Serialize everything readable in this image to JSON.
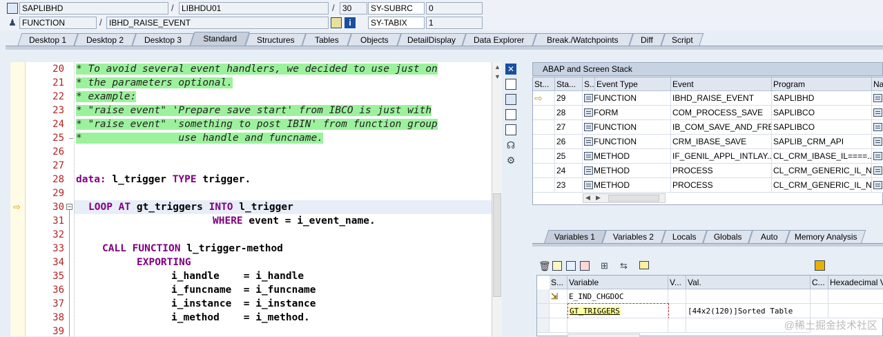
{
  "header": {
    "row1": {
      "program": "SAPLIBHD",
      "include": "LIBHDU01",
      "line": "30",
      "var_name": "SY-SUBRC",
      "var_value": "0"
    },
    "row2": {
      "type": "FUNCTION",
      "name": "IBHD_RAISE_EVENT",
      "var_name": "SY-TABIX",
      "var_value": "1"
    }
  },
  "tabs": [
    "Desktop 1",
    "Desktop 2",
    "Desktop 3",
    "Standard",
    "Structures",
    "Tables",
    "Objects",
    "DetailDisplay",
    "Data Explorer",
    "Break./Watchpoints",
    "Diff",
    "Script"
  ],
  "active_tab": "Standard",
  "code": {
    "line_numbers": [
      "20",
      "21",
      "22",
      "23",
      "24",
      "25",
      "26",
      "27",
      "28",
      "29",
      "30",
      "31",
      "32",
      "33",
      "34",
      "35",
      "36",
      "37",
      "38",
      "39"
    ],
    "lines": {
      "l20": "* To avoid several event handlers, we decided to use just on",
      "l21": "* the parameters optional.",
      "l22": "* example:",
      "l23": "* \"raise event\" 'Prepare save start' from IBCO is just with",
      "l24": "* \"raise event\" 'something to post IBIN' from function group",
      "l25": "*                use handle and funcname.",
      "l28_kw": "data:",
      "l28_rest": " l_trigger ",
      "l28_kw2": "TYPE",
      "l28_rest2": " trigger.",
      "l30_kw": "LOOP AT",
      "l30_a": " gt_triggers ",
      "l30_kw2": "INTO",
      "l30_b": " l_trigger",
      "l31_kw": "WHERE",
      "l31_rest": " event = i_event_name.",
      "l33_kw": "CALL FUNCTION",
      "l33_rest": " l_trigger-method",
      "l34_kw": "EXPORTING",
      "l35": "i_handle    = i_handle",
      "l36": "i_funcname  = i_funcname",
      "l37": "i_instance  = i_instance",
      "l38": "i_method    = i_method."
    }
  },
  "stack": {
    "title": "ABAP and Screen Stack",
    "columns": [
      "St...",
      "Sta...",
      "S...",
      "Event Type",
      "Event",
      "Program",
      "Na"
    ],
    "rows": [
      {
        "level": "29",
        "type": "FUNCTION",
        "event": "IBHD_RAISE_EVENT",
        "program": "SAPLIBHD",
        "current": true
      },
      {
        "level": "28",
        "type": "FORM",
        "event": "COM_PROCESS_SAVE",
        "program": "SAPLIBCO",
        "current": false
      },
      {
        "level": "27",
        "type": "FUNCTION",
        "event": "IB_COM_SAVE_AND_FRE...",
        "program": "SAPLIBCO",
        "current": false
      },
      {
        "level": "26",
        "type": "FUNCTION",
        "event": "CRM_IBASE_SAVE",
        "program": "SAPLIB_CRM_API",
        "current": false
      },
      {
        "level": "25",
        "type": "METHOD",
        "event": "IF_GENIL_APPL_INTLAY...",
        "program": "CL_CRM_IBASE_IL====...",
        "current": false
      },
      {
        "level": "24",
        "type": "METHOD",
        "event": "PROCESS",
        "program": "CL_CRM_GENERIC_IL_NE...",
        "current": false
      },
      {
        "level": "23",
        "type": "METHOD",
        "event": "PROCESS",
        "program": "CL_CRM_GENERIC_IL_NE...",
        "current": false
      }
    ]
  },
  "var_tabs": [
    "Variables 1",
    "Variables 2",
    "Locals",
    "Globals",
    "Auto",
    "Memory Analysis"
  ],
  "active_var_tab": "Variables 1",
  "variables": {
    "columns": [
      "S...",
      "Variable",
      "V...",
      "Val.",
      "C...",
      "Hexadecimal V"
    ],
    "rows": [
      {
        "name": "E_IND_CHGDOC",
        "value": ""
      },
      {
        "name": "GT_TRIGGERS",
        "value": "[44x2(120)]Sorted Table"
      }
    ]
  },
  "watermark": "@稀土掘金技术社区"
}
